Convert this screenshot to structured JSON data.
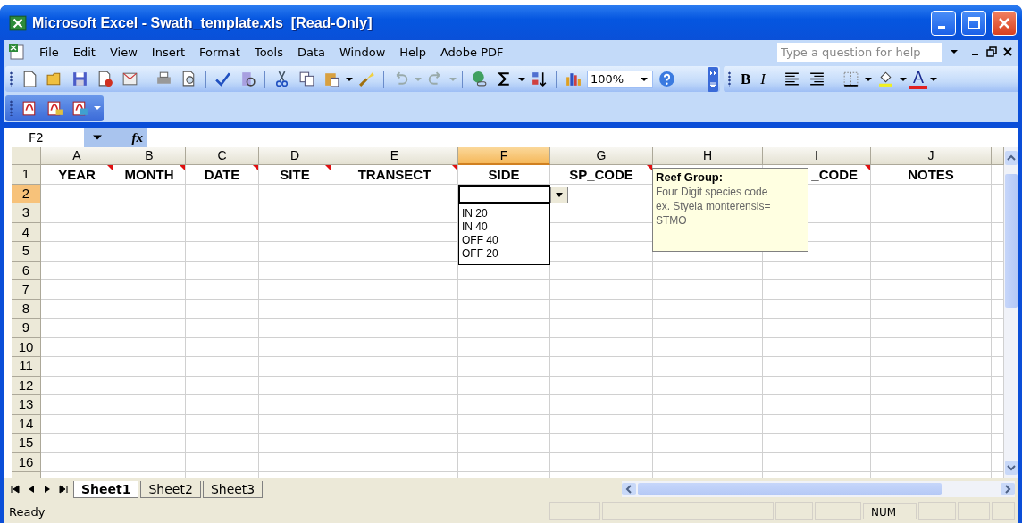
{
  "window": {
    "title": "Microsoft Excel - Swath_template.xls  [Read-Only]"
  },
  "menu": [
    "File",
    "Edit",
    "View",
    "Insert",
    "Format",
    "Tools",
    "Data",
    "Window",
    "Help",
    "Adobe PDF"
  ],
  "help_box": {
    "placeholder": "Type a question for help"
  },
  "toolbar": {
    "zoom": "100%",
    "bold": "B",
    "italic": "I",
    "font_color": "A"
  },
  "formula_bar": {
    "name_box": "F2",
    "function_label": "fx"
  },
  "columns": [
    {
      "label": "A",
      "selected": false
    },
    {
      "label": "B",
      "selected": false
    },
    {
      "label": "C",
      "selected": false
    },
    {
      "label": "D",
      "selected": false
    },
    {
      "label": "E",
      "selected": false
    },
    {
      "label": "F",
      "selected": true
    },
    {
      "label": "G",
      "selected": false
    },
    {
      "label": "H",
      "selected": false
    },
    {
      "label": "I",
      "selected": false
    },
    {
      "label": "J",
      "selected": false
    }
  ],
  "rows": [
    {
      "label": "1",
      "selected": false
    },
    {
      "label": "2",
      "selected": true
    },
    {
      "label": "3",
      "selected": false
    },
    {
      "label": "4",
      "selected": false
    },
    {
      "label": "5",
      "selected": false
    },
    {
      "label": "6",
      "selected": false
    },
    {
      "label": "7",
      "selected": false
    },
    {
      "label": "8",
      "selected": false
    },
    {
      "label": "9",
      "selected": false
    },
    {
      "label": "10",
      "selected": false
    },
    {
      "label": "11",
      "selected": false
    },
    {
      "label": "12",
      "selected": false
    },
    {
      "label": "13",
      "selected": false
    },
    {
      "label": "14",
      "selected": false
    },
    {
      "label": "15",
      "selected": false
    },
    {
      "label": "16",
      "selected": false
    }
  ],
  "header_cells": [
    {
      "text": "YEAR",
      "commented": true
    },
    {
      "text": "MONTH",
      "commented": true
    },
    {
      "text": "DATE",
      "commented": true
    },
    {
      "text": "SITE",
      "commented": true
    },
    {
      "text": "TRANSECT",
      "commented": true
    },
    {
      "text": "SIDE",
      "commented": false
    },
    {
      "text": "SP_CODE",
      "commented": true
    },
    null,
    {
      "text": "_CODE",
      "commented": true
    },
    {
      "text": "NOTES",
      "commented": false
    }
  ],
  "validation_list": {
    "options": [
      "IN 20",
      "IN 40",
      "OFF 40",
      "OFF 20"
    ]
  },
  "comment": {
    "title": "Reef Group:",
    "lines": [
      "Four Digit species code",
      "ex. Styela monterensis=",
      "STMO"
    ]
  },
  "sheet_tabs": [
    {
      "label": "Sheet1",
      "selected": true
    },
    {
      "label": "Sheet2",
      "selected": false
    },
    {
      "label": "Sheet3",
      "selected": false
    }
  ],
  "status_bar": {
    "status": "Ready",
    "indicator": "NUM"
  }
}
